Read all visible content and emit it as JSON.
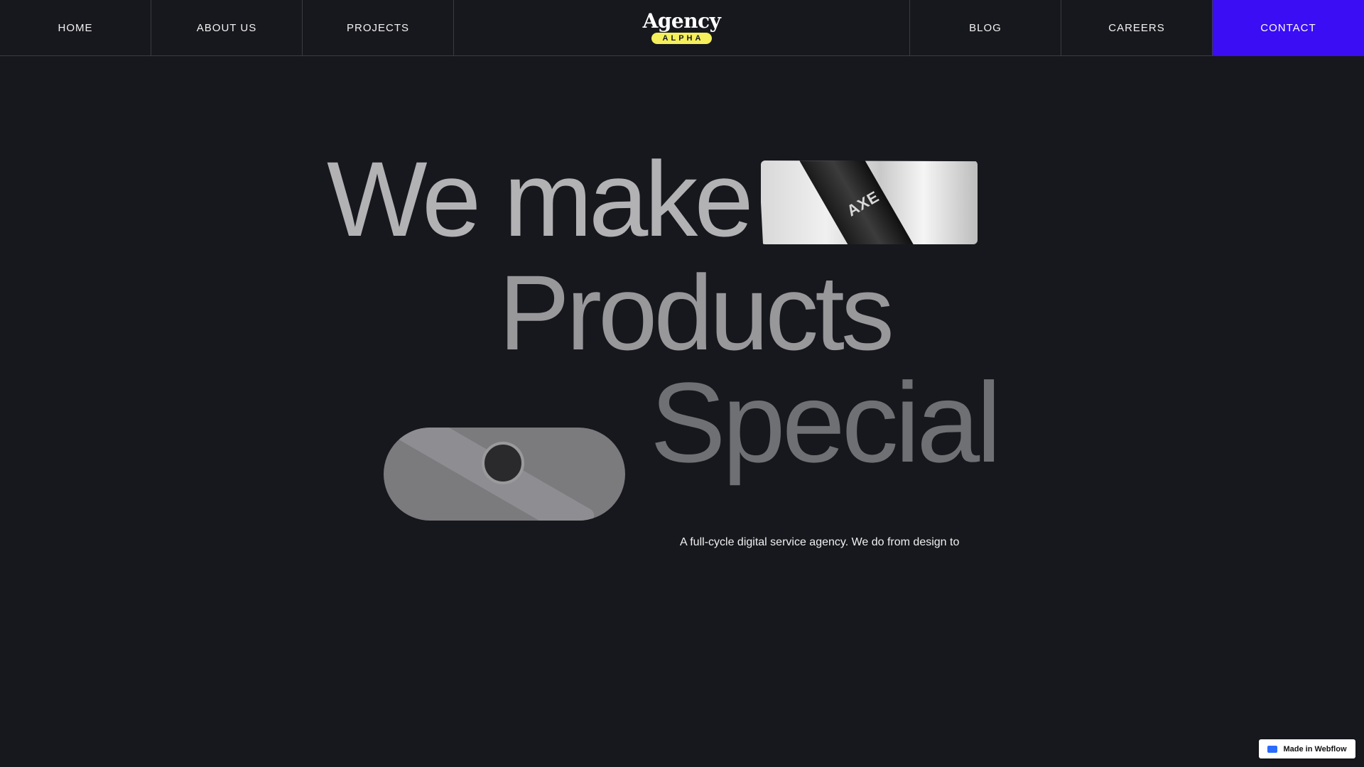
{
  "nav": {
    "items_left": [
      "HOME",
      "ABOUT US",
      "PROJECTS"
    ],
    "logo": {
      "word": "Agency",
      "badge": "ALPHA"
    },
    "items_right": [
      "BLOG",
      "CAREERS"
    ],
    "cta": "CONTACT",
    "accent": "#3a0df5"
  },
  "hero": {
    "line1": "We make",
    "line2": "Products",
    "line3": "Special",
    "image1": {
      "brand": "AXE"
    },
    "tagline": "A full-cycle digital service agency. We do from design to"
  },
  "badge": {
    "label": "Made in Webflow"
  }
}
